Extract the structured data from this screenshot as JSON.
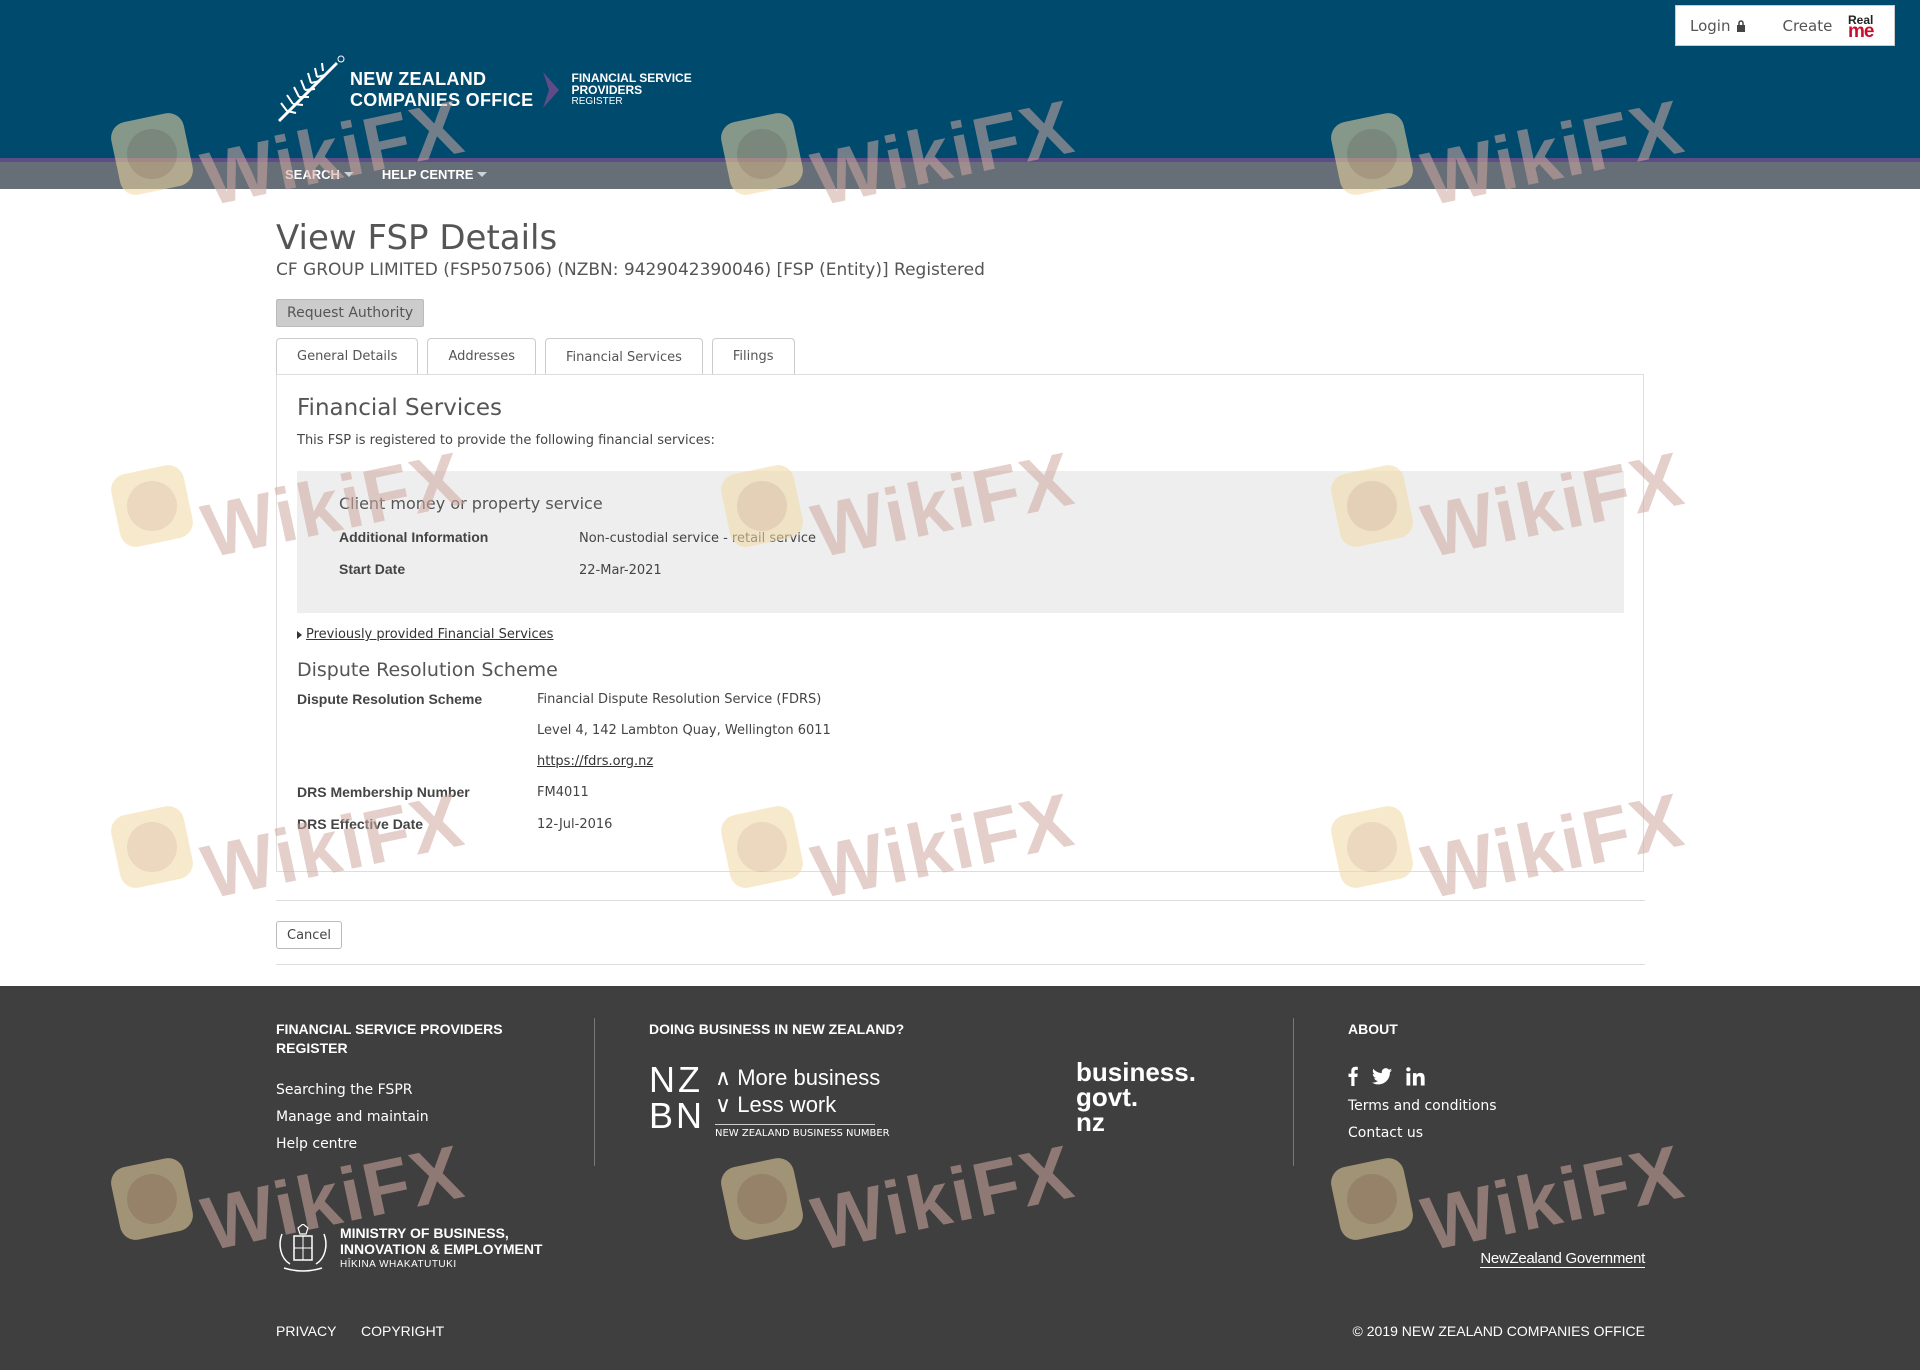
{
  "header": {
    "login_label": "Login",
    "create_label": "Create",
    "realme_top": "Real",
    "realme_bottom": "me",
    "logo_line1": "NEW ZEALAND",
    "logo_line2": "COMPANIES OFFICE",
    "logo_sub1": "FINANCIAL SERVICE",
    "logo_sub2": "PROVIDERS",
    "logo_sub3": "REGISTER",
    "bg_color": "#004a6d",
    "band_color": "#666f77",
    "accent_color": "#5e4c86"
  },
  "nav": {
    "items": [
      {
        "label": "SEARCH"
      },
      {
        "label": "HELP CENTRE"
      }
    ]
  },
  "page": {
    "title": "View FSP Details",
    "subtitle": "CF GROUP LIMITED (FSP507506) (NZBN: 9429042390046) [FSP (Entity)] Registered",
    "request_authority_label": "Request Authority",
    "cancel_label": "Cancel"
  },
  "tabs": [
    {
      "label": "General Details",
      "active": false
    },
    {
      "label": "Addresses",
      "active": false
    },
    {
      "label": "Financial Services",
      "active": true
    },
    {
      "label": "Filings",
      "active": false
    }
  ],
  "financial_services": {
    "title": "Financial Services",
    "intro": "This FSP is registered to provide the following financial services:",
    "service": {
      "name": "Client money or property service",
      "additional_info_label": "Additional Information",
      "additional_info_value": "Non-custodial service - retail service",
      "start_date_label": "Start Date",
      "start_date_value": "22-Mar-2021"
    },
    "previous_link": "Previously provided Financial Services"
  },
  "dispute": {
    "title": "Dispute Resolution Scheme",
    "scheme_label": "Dispute Resolution Scheme",
    "scheme_name": "Financial Dispute Resolution Service (FDRS)",
    "scheme_address": "Level 4, 142 Lambton Quay, Wellington 6011",
    "scheme_url": "https://fdrs.org.nz",
    "membership_label": "DRS Membership Number",
    "membership_value": "FM4011",
    "effective_label": "DRS Effective Date",
    "effective_value": "12-Jul-2016"
  },
  "footer": {
    "col1_heading_line1": "FINANCIAL SERVICE PROVIDERS",
    "col1_heading_line2": "REGISTER",
    "col1_links": [
      "Searching the FSPR",
      "Manage and maintain",
      "Help centre"
    ],
    "col2_heading": "DOING BUSINESS IN NEW ZEALAND?",
    "nzbn_big_line1": "NZ",
    "nzbn_big_line2": "BN",
    "nzbn_line1": "More business",
    "nzbn_line2": "Less work",
    "nzbn_caption": "NEW ZEALAND BUSINESS NUMBER",
    "bgn_line1": "business.",
    "bgn_line2": "govt.",
    "bgn_line3": "nz",
    "col3_heading": "ABOUT",
    "col3_links": [
      "Terms and conditions",
      "Contact us"
    ],
    "social_icons": [
      "facebook-icon",
      "twitter-icon",
      "linkedin-icon"
    ],
    "mbie_line1": "MINISTRY OF BUSINESS,",
    "mbie_line2": "INNOVATION & EMPLOYMENT",
    "mbie_sub": "HĪKINA WHAKATUTUKI",
    "nzgov": "NewZealand Government",
    "privacy_label": "PRIVACY",
    "copyright_label": "COPYRIGHT",
    "copyright_text": "© 2019 NEW ZEALAND COMPANIES OFFICE",
    "bg_color": "#3f3f3f"
  },
  "watermark": {
    "text": "WikiFX"
  }
}
